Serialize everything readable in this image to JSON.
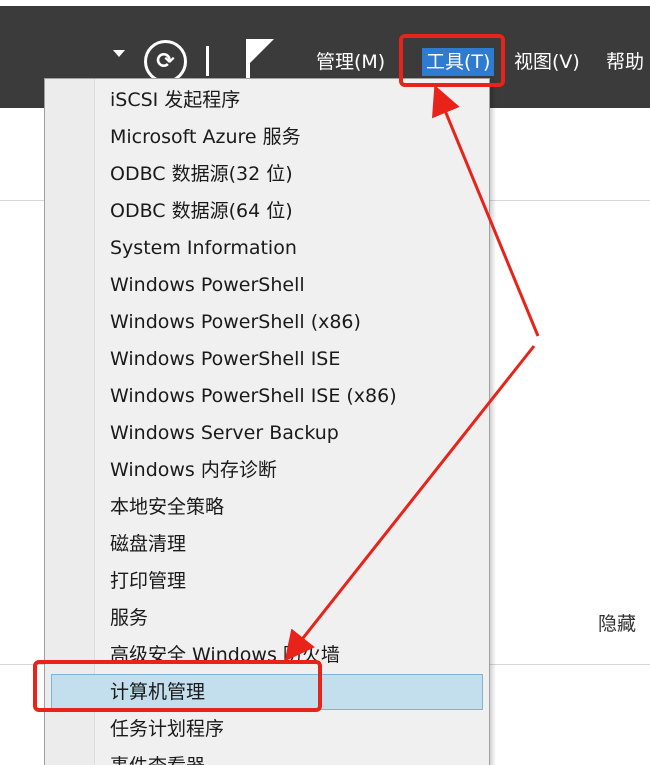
{
  "toolbar": {
    "refresh_glyph": "⟳",
    "menus": {
      "manage": "管理(M)",
      "tools": "工具(T)",
      "view": "视图(V)",
      "help": "帮助"
    }
  },
  "background": {
    "hide_label": "隐藏"
  },
  "tools_menu": {
    "items": [
      "iSCSI 发起程序",
      "Microsoft Azure 服务",
      "ODBC 数据源(32 位)",
      "ODBC 数据源(64 位)",
      "System Information",
      "Windows PowerShell",
      "Windows PowerShell (x86)",
      "Windows PowerShell ISE",
      "Windows PowerShell ISE (x86)",
      "Windows Server Backup",
      "Windows 内存诊断",
      "本地安全策略",
      "磁盘清理",
      "打印管理",
      "服务",
      "高级安全 Windows 防火墙",
      "计算机管理",
      "任务计划程序",
      "事件查看器"
    ],
    "selected_index": 16
  },
  "colors": {
    "toolbar_bg": "#3b3b3b",
    "tools_highlight": "#2e7bd0",
    "menu_bg": "#f0f0f0",
    "selected_bg": "#c3dfee",
    "annotation_red": "#e8231a"
  }
}
